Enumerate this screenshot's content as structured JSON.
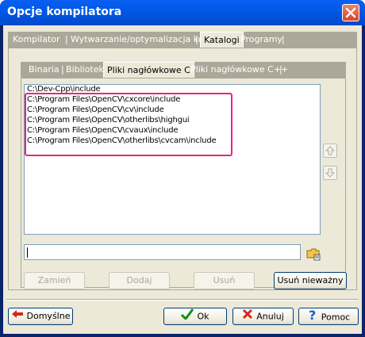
{
  "window": {
    "title": "Opcje kompilatora"
  },
  "tabs": [
    {
      "label": "Kompilator"
    },
    {
      "label": "Wytwarzanie/optymalizacja kodu"
    },
    {
      "label": "Katalogi"
    },
    {
      "label": "Programy"
    }
  ],
  "subtabs": [
    {
      "label": "Binaria"
    },
    {
      "label": "Biblioteki"
    },
    {
      "label": "Pliki nagłówkowe C"
    },
    {
      "label": "Pliki nagłówkowe C++"
    }
  ],
  "directories": [
    "C:\\Dev-Cpp\\include",
    "C:\\Program Files\\OpenCV\\cxcore\\include",
    "C:\\Program Files\\OpenCV\\cv\\include",
    "C:\\Program Files\\OpenCV\\otherlibs\\highgui",
    "C:\\Program Files\\OpenCV\\cvaux\\include",
    "C:\\Program Files\\OpenCV\\otherlibs\\cvcam\\include"
  ],
  "path_input": {
    "value": ""
  },
  "buttons": {
    "replace": "Zamień",
    "add": "Dodaj",
    "delete": "Usuń",
    "delete_invalid": "Usuń nieważny",
    "defaults": "Domyślne",
    "ok": "Ok",
    "cancel": "Anuluj",
    "help": "Pomoc"
  },
  "icons": {
    "move_up": "arrow-up-icon",
    "move_down": "arrow-down-icon",
    "browse": "folder-icon"
  },
  "colors": {
    "title_bar": "#0058e6",
    "highlight_box": "#e0287d",
    "dialog_bg": "#ece9d8"
  }
}
